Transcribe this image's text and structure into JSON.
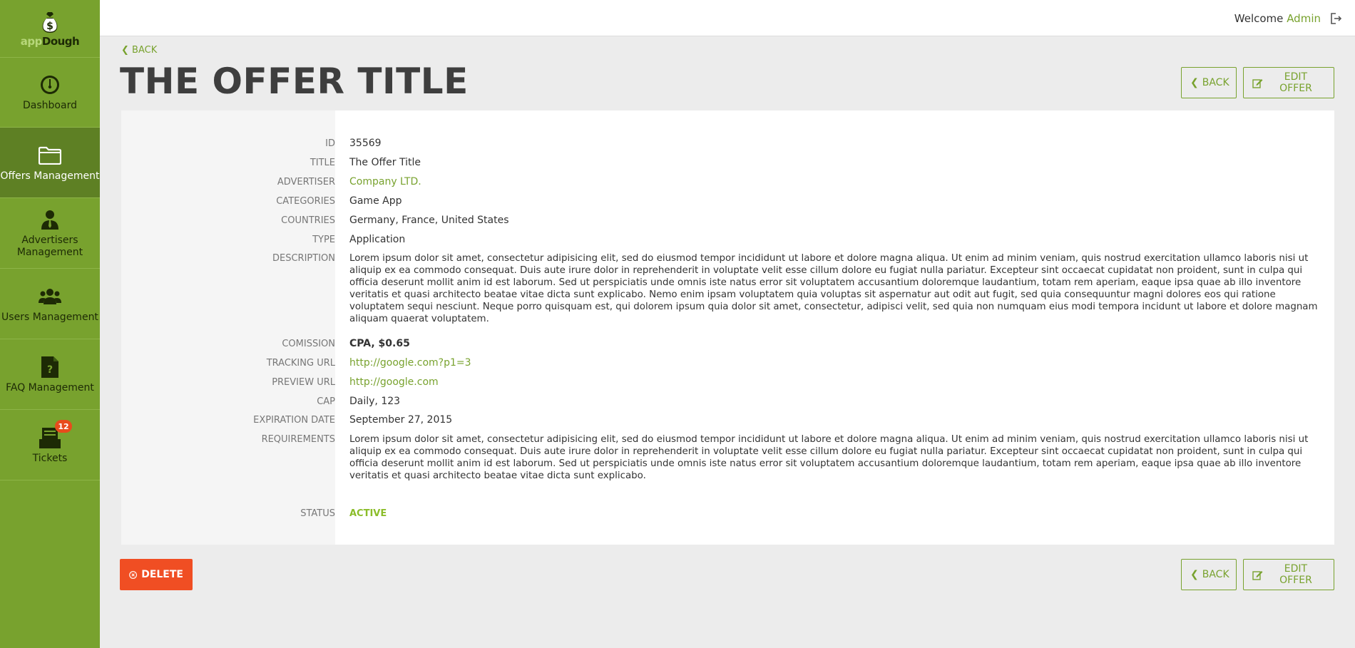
{
  "sidebar": {
    "logo": {
      "part1": "app",
      "part2": "Dough"
    },
    "items": [
      {
        "label": "Dashboard",
        "icon": "gauge-icon"
      },
      {
        "label": "Offers Management",
        "icon": "folder-icon"
      },
      {
        "label": "Advertisers Management",
        "icon": "person-tie-icon"
      },
      {
        "label": "Users Management",
        "icon": "users-icon"
      },
      {
        "label": "FAQ Management",
        "icon": "question-document-icon"
      },
      {
        "label": "Tickets",
        "icon": "inbox-tray-icon",
        "badge": "12"
      }
    ]
  },
  "header": {
    "welcome": "Welcome",
    "user": "Admin"
  },
  "page": {
    "back_link": "BACK",
    "title": "THE OFFER TITLE"
  },
  "buttons": {
    "back": "BACK",
    "edit": "EDIT OFFER",
    "delete": "DELETE"
  },
  "details": {
    "id": {
      "label": "ID",
      "value": "35569"
    },
    "title": {
      "label": "TITLE",
      "value": "The Offer Title"
    },
    "advertiser": {
      "label": "ADVERTISER",
      "value": "Company LTD."
    },
    "categories": {
      "label": "CATEGORIES",
      "value": "Game App"
    },
    "countries": {
      "label": "COUNTRIES",
      "value": "Germany, France, United States"
    },
    "type": {
      "label": "TYPE",
      "value": "Application"
    },
    "description": {
      "label": "DESCRIPTION",
      "value": "Lorem ipsum dolor sit amet, consectetur adipisicing elit, sed do eiusmod tempor incididunt ut labore et dolore magna aliqua. Ut enim ad minim veniam, quis nostrud exercitation ullamco laboris nisi ut aliquip ex ea commodo consequat. Duis aute irure dolor in reprehenderit in voluptate velit esse cillum dolore eu fugiat nulla pariatur. Excepteur sint occaecat cupidatat non proident, sunt in culpa qui officia deserunt mollit anim id est laborum. Sed ut perspiciatis unde omnis iste natus error sit voluptatem accusantium doloremque laudantium, totam rem aperiam, eaque ipsa quae ab illo inventore veritatis et quasi architecto beatae vitae dicta sunt explicabo. Nemo enim ipsam voluptatem quia voluptas sit aspernatur aut odit aut fugit, sed quia consequuntur magni dolores eos qui ratione voluptatem sequi nesciunt. Neque porro quisquam est, qui dolorem ipsum quia dolor sit amet, consectetur, adipisci velit, sed quia non numquam eius modi tempora incidunt ut labore et dolore magnam aliquam quaerat voluptatem."
    },
    "commission": {
      "label": "COMISSION",
      "value": "CPA, $0.65"
    },
    "tracking_url": {
      "label": "TRACKING URL",
      "value": "http://google.com?p1=3"
    },
    "preview_url": {
      "label": "PREVIEW URL",
      "value": "http://google.com"
    },
    "cap": {
      "label": "CAP",
      "value": "Daily, 123"
    },
    "expiration": {
      "label": "EXPIRATION DATE",
      "value": "September 27, 2015"
    },
    "requirements": {
      "label": "REQUIREMENTS",
      "value": "Lorem ipsum dolor sit amet, consectetur adipisicing elit, sed do eiusmod tempor incididunt ut labore et dolore magna aliqua. Ut enim ad minim veniam, quis nostrud exercitation ullamco laboris nisi ut aliquip ex ea commodo consequat. Duis aute irure dolor in reprehenderit in voluptate velit esse cillum dolore eu fugiat nulla pariatur. Excepteur sint occaecat cupidatat non proident, sunt in culpa qui officia deserunt mollit anim id est laborum. Sed ut perspiciatis unde omnis iste natus error sit voluptatem accusantium doloremque laudantium, totam rem aperiam, eaque ipsa quae ab illo inventore veritatis et quasi architecto beatae vitae dicta sunt explicabo."
    },
    "status": {
      "label": "STATUS",
      "value": "ACTIVE"
    }
  },
  "colors": {
    "sidebar": "#78a22e",
    "sidebar_active": "#5e8024",
    "accent": "#78a22e",
    "danger": "#f04e23",
    "badge": "#e84b1c"
  }
}
